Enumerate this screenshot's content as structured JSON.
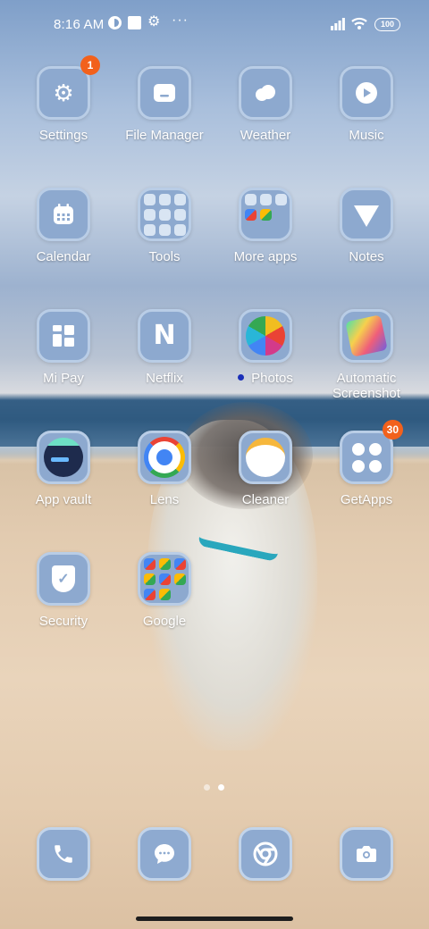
{
  "status_bar": {
    "time": "8:16 AM",
    "icons": [
      "notification-circle-icon",
      "notification-square-icon",
      "gear-icon",
      "more-dots-icon",
      "signal-icon",
      "wifi-icon"
    ],
    "more": "···",
    "battery": "100"
  },
  "apps": [
    {
      "label": "Settings",
      "icon": "gear-icon",
      "badge": "1"
    },
    {
      "label": "File Manager",
      "icon": "folder-icon"
    },
    {
      "label": "Weather",
      "icon": "cloud-icon"
    },
    {
      "label": "Music",
      "icon": "play-icon"
    },
    {
      "label": "Calendar",
      "icon": "calendar-icon"
    },
    {
      "label": "Tools",
      "icon": "folder-preview-icon"
    },
    {
      "label": "More apps",
      "icon": "folder-preview-icon"
    },
    {
      "label": "Notes",
      "icon": "notes-icon"
    },
    {
      "label": "Mi Pay",
      "icon": "mi-pay-icon"
    },
    {
      "label": "Netflix",
      "icon": "netflix-icon",
      "glyph": "N"
    },
    {
      "label": "Photos",
      "icon": "photos-pinwheel-icon"
    },
    {
      "label": "Automatic Screenshot",
      "icon": "screenshot-art-icon"
    },
    {
      "label": "App vault",
      "icon": "app-vault-icon"
    },
    {
      "label": "Lens",
      "icon": "lens-icon"
    },
    {
      "label": "Cleaner",
      "icon": "cleaner-icon"
    },
    {
      "label": "GetApps",
      "icon": "get-apps-icon",
      "badge": "30"
    },
    {
      "label": "Security",
      "icon": "shield-icon"
    },
    {
      "label": "Google",
      "icon": "folder-preview-icon"
    }
  ],
  "page_indicator": {
    "pages": 2,
    "current": 2
  },
  "dock": [
    {
      "name": "phone",
      "icon": "phone-icon"
    },
    {
      "name": "messages",
      "icon": "message-icon"
    },
    {
      "name": "chrome",
      "icon": "chrome-icon"
    },
    {
      "name": "camera",
      "icon": "camera-icon"
    }
  ],
  "colors": {
    "tile": "#8da9cf",
    "tile_border": "#b9cde6",
    "badge": "#f2611c",
    "photos_dot": "#1a2fb8"
  }
}
